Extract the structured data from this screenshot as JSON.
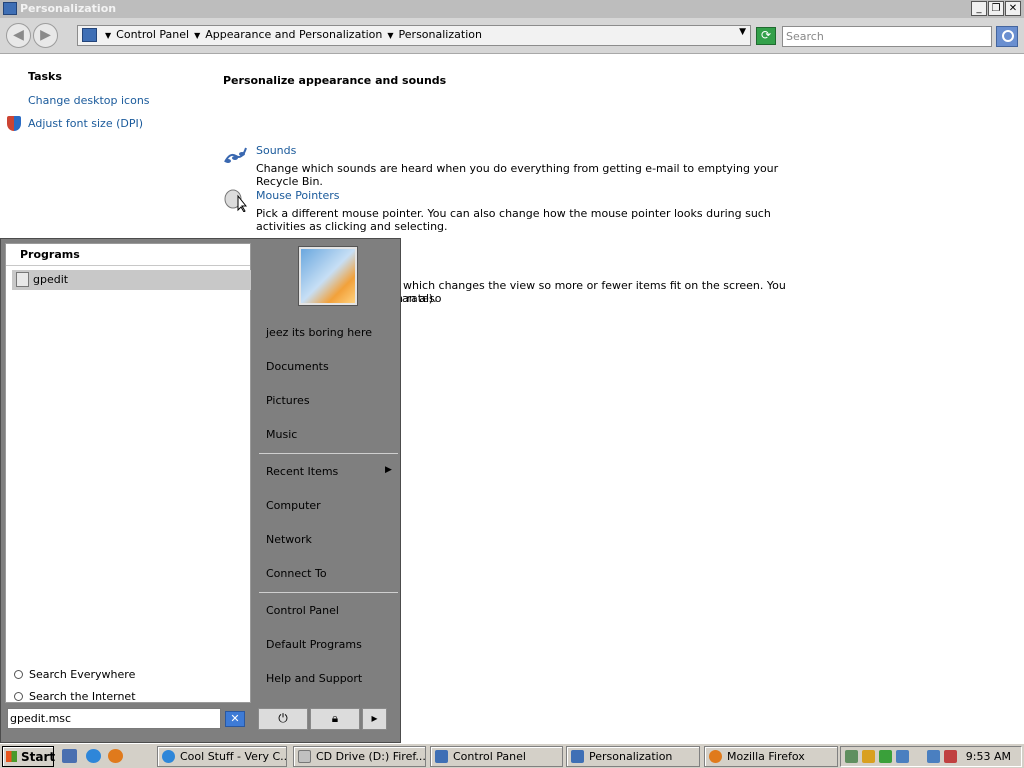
{
  "window": {
    "title": "Personalization"
  },
  "address_bar": {
    "crumbs": [
      "Control Panel",
      "Appearance and Personalization",
      "Personalization"
    ],
    "search_placeholder": "Search"
  },
  "tasks": {
    "title": "Tasks",
    "links": [
      "Change desktop icons",
      "Adjust font size (DPI)"
    ]
  },
  "main": {
    "title": "Personalize appearance and sounds",
    "items": [
      {
        "title": "Sounds",
        "desc": "Change which sounds are heard when you do everything from getting e-mail to emptying your Recycle Bin."
      },
      {
        "title": "Mouse Pointers",
        "desc": "Pick a different mouse pointer. You can also change how the mouse pointer looks during such activities as clicking and selecting."
      }
    ],
    "partial_line_1": ", which changes the view so more or fewer items fit on the screen. You can also",
    "partial_line_2": "n rate)."
  },
  "start_menu": {
    "programs_header": "Programs",
    "program_result": "gpedit",
    "search_everywhere": "Search Everywhere",
    "search_internet": "Search the Internet",
    "search_value": "gpedit.msc",
    "right_items": {
      "user": "jeez its boring here",
      "documents": "Documents",
      "pictures": "Pictures",
      "music": "Music",
      "recent": "Recent Items",
      "computer": "Computer",
      "network": "Network",
      "connect": "Connect To",
      "control_panel": "Control Panel",
      "default_programs": "Default Programs",
      "help": "Help and Support"
    }
  },
  "taskbar": {
    "start_label": "Start",
    "tasks": [
      "Cool Stuff - Very C...",
      "CD Drive (D:) Firef...",
      "Control Panel",
      "Personalization",
      "Mozilla Firefox"
    ],
    "clock": "9:53 AM"
  }
}
